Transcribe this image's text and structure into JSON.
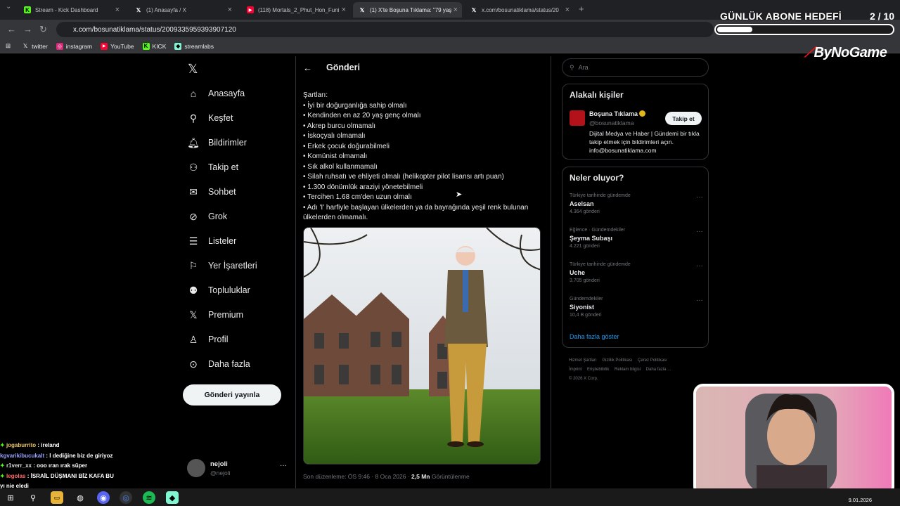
{
  "browser": {
    "tabs": [
      {
        "label": "Stream - Kick Dashboard",
        "icon": "kick-icon",
        "active": false
      },
      {
        "label": "(1) Anasayfa / X",
        "icon": "x-logo-icon",
        "active": false
      },
      {
        "label": "(118) Mortals_2_Phut_Hon_Funi",
        "icon": "youtube-icon",
        "active": false
      },
      {
        "label": "(1) X'te Boşuna Tıklama: \"79 yaş",
        "icon": "x-logo-icon",
        "active": true
      },
      {
        "label": "x.com/bosunatiklama/status/20",
        "icon": "x-logo-icon",
        "active": false
      }
    ],
    "url": "x.com/bosunatiklama/status/2009335959393907120",
    "bookmarks": [
      "twitter",
      "instagram",
      "YouTube",
      "KICK",
      "streamlabs"
    ]
  },
  "overlay": {
    "goal_title": "GÜNLÜK ABONE HEDEFİ",
    "goal_count": "2  / 10",
    "goal_progress": 0.2,
    "logo": "ByNoGame"
  },
  "nav": {
    "items": [
      {
        "label": "Anasayfa",
        "icon": "home-icon"
      },
      {
        "label": "Keşfet",
        "icon": "search-icon"
      },
      {
        "label": "Bildirimler",
        "icon": "bell-icon"
      },
      {
        "label": "Takip et",
        "icon": "follow-icon"
      },
      {
        "label": "Sohbet",
        "icon": "mail-icon"
      },
      {
        "label": "Grok",
        "icon": "grok-icon"
      },
      {
        "label": "Listeler",
        "icon": "list-icon"
      },
      {
        "label": "Yer İşaretleri",
        "icon": "bookmark-icon"
      },
      {
        "label": "Topluluklar",
        "icon": "communities-icon"
      },
      {
        "label": "Premium",
        "icon": "x-logo-icon"
      },
      {
        "label": "Profil",
        "icon": "profile-icon"
      },
      {
        "label": "Daha fazla",
        "icon": "more-icon"
      }
    ],
    "post_button": "Gönderi yayınla",
    "account": {
      "name": "nejoli",
      "handle": "@nejoli"
    }
  },
  "post": {
    "header": "Gönderi",
    "lines": [
      "Şartları:",
      "• İyi bir doğurganlığa sahip olmalı",
      "• Kendinden en az 20 yaş genç olmalı",
      "• Akrep burcu olmamalı",
      "• İskoçyalı olmamalı",
      "• Erkek çocuk doğurabilmeli",
      "• Komünist olmamalı",
      "• Sık alkol kullanmamalı",
      "• Silah ruhsatı ve ehliyeti olmalı (helikopter pilot lisansı artı puan)",
      "• 1.300 dönümlük araziyi yönetebilmeli",
      "• Tercihen 1.68 cm'den uzun olmalı",
      "• Adı 'I' harfiyle başlayan ülkelerden ya da bayrağında yeşil renk bulunan ülkelerden olmamalı."
    ],
    "meta_time": "Son düzenleme: ÖS 9:46 · 8 Oca 2026 · ",
    "meta_views": "2,5 Mn",
    "meta_views_label": " Görüntülenme"
  },
  "sidebar": {
    "search_placeholder": "Ara",
    "related_title": "Alakalı kişiler",
    "related": {
      "name": "Boşuna Tıklama",
      "handle": "@bosunatiklama",
      "follow": "Takip et",
      "bio": "Dijital Medya ve Haber | Gündemi bir tıkla takip etmek için bildirimleri açın. info@bosunatiklama.com"
    },
    "trends_title": "Neler oluyor?",
    "trends": [
      {
        "context": "Türkiye tarihinde gündemde",
        "name": "Aselsan",
        "posts": "4.364 gönderi"
      },
      {
        "context": "Eğlence · Gündemdekiler",
        "name": "Şeyma Subaşı",
        "posts": "4.221 gönderi"
      },
      {
        "context": "Türkiye tarihinde gündemde",
        "name": "Uche",
        "posts": "3.705 gönderi"
      },
      {
        "context": "Gündemdekiler",
        "name": "Siyonist",
        "posts": "10,4 B gönderi"
      }
    ],
    "show_more": "Daha fazla göster",
    "footer": [
      "Hizmet Şartları",
      "Gizlilik Politikası",
      "Çerez Politikası",
      "İmprint",
      "Erişilebilirlik",
      "Reklam bilgisi",
      "Daha fazla ...",
      "© 2026 X Corp."
    ]
  },
  "chat": [
    {
      "user": "jogaburrito",
      "msg": " : ireland"
    },
    {
      "user": "kgvarikibucukalt",
      "msg": " : I dediğine biz de giriyoz"
    },
    {
      "user": "r1verr_xx",
      "msg": " : ooo ıran ırak süper"
    },
    {
      "user": "legolas",
      "msg": " : İSRAİL DÜŞMANI BİZ KAFA BU"
    },
    {
      "user": "",
      "msg": "yı nie eledi"
    }
  ],
  "taskbar": {
    "date": "9.01.2026"
  }
}
